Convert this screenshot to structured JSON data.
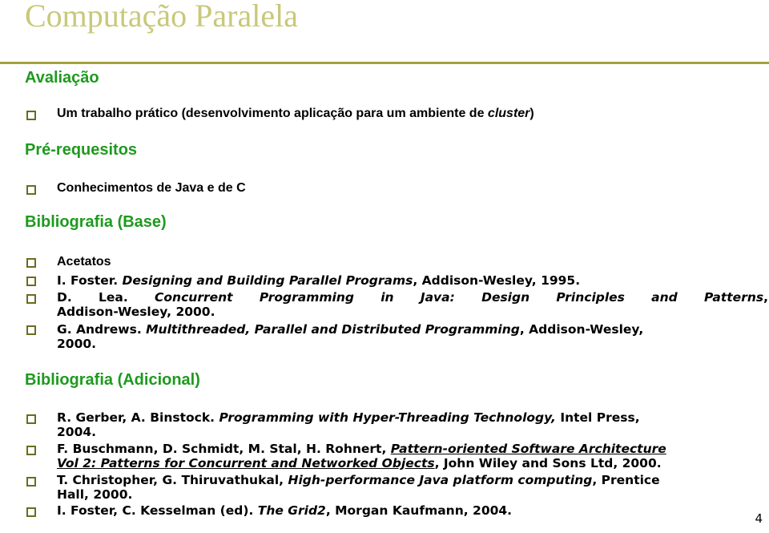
{
  "slide": {
    "title": "Computação Paralela",
    "page_number": "4",
    "accent_colors": {
      "title": "#c8c87a",
      "rule": "#a3a33a",
      "heading": "#1e9a1e",
      "bullet": "#6b6b1f"
    }
  },
  "sections": {
    "avaliacao": {
      "heading": "Avaliação",
      "items": [
        {
          "pre": "Um trabalho prático (desenvolvimento aplicação para um ambiente de ",
          "italic": "cluster",
          "post": ")"
        }
      ]
    },
    "prerequisitos": {
      "heading": "Pré-requesitos",
      "items": [
        {
          "text": "Conhecimentos de Java e de C"
        }
      ]
    },
    "bib_base": {
      "heading": "Bibliografia (Base)",
      "items": [
        {
          "text": "Acetatos"
        },
        {
          "author": "I. Foster. ",
          "title": "Designing and Building Parallel Programs",
          "rest": ", Addison-Wesley, 1995."
        },
        {
          "author": "D. Lea. ",
          "title": "Concurrent Programming in Java: Design Principles and Patterns",
          "rest": ",",
          "line2": "Addison-Wesley, 2000."
        },
        {
          "author": "G. Andrews. ",
          "title": "Multithreaded, Parallel and Distributed Programming",
          "rest": ", Addison-Wesley,",
          "line2": "2000."
        }
      ]
    },
    "bib_adicional": {
      "heading": "Bibliografia (Adicional)",
      "items": [
        {
          "author": "R. Gerber, A. Binstock. ",
          "title": "Programming with Hyper-Threading Technology,",
          "rest": " Intel Press,",
          "line2": "2004."
        },
        {
          "author": "F. Buschmann, D. Schmidt, M. Stal, H. Rohnert, ",
          "title": "Pattern-oriented Software Architecture",
          "line2_title": "Vol 2: Patterns for Concurrent and Networked Objects",
          "line2_rest": ", John Wiley and Sons Ltd, 2000."
        },
        {
          "author": "T. Christopher, G. Thiruvathukal, ",
          "title": "High-performance Java platform computing",
          "rest": ", Prentice",
          "line2": "Hall, 2000."
        },
        {
          "author": "I. Foster, C. Kesselman (ed). ",
          "title": "The Grid2",
          "rest": ", Morgan Kaufmann, 2004."
        }
      ]
    }
  }
}
